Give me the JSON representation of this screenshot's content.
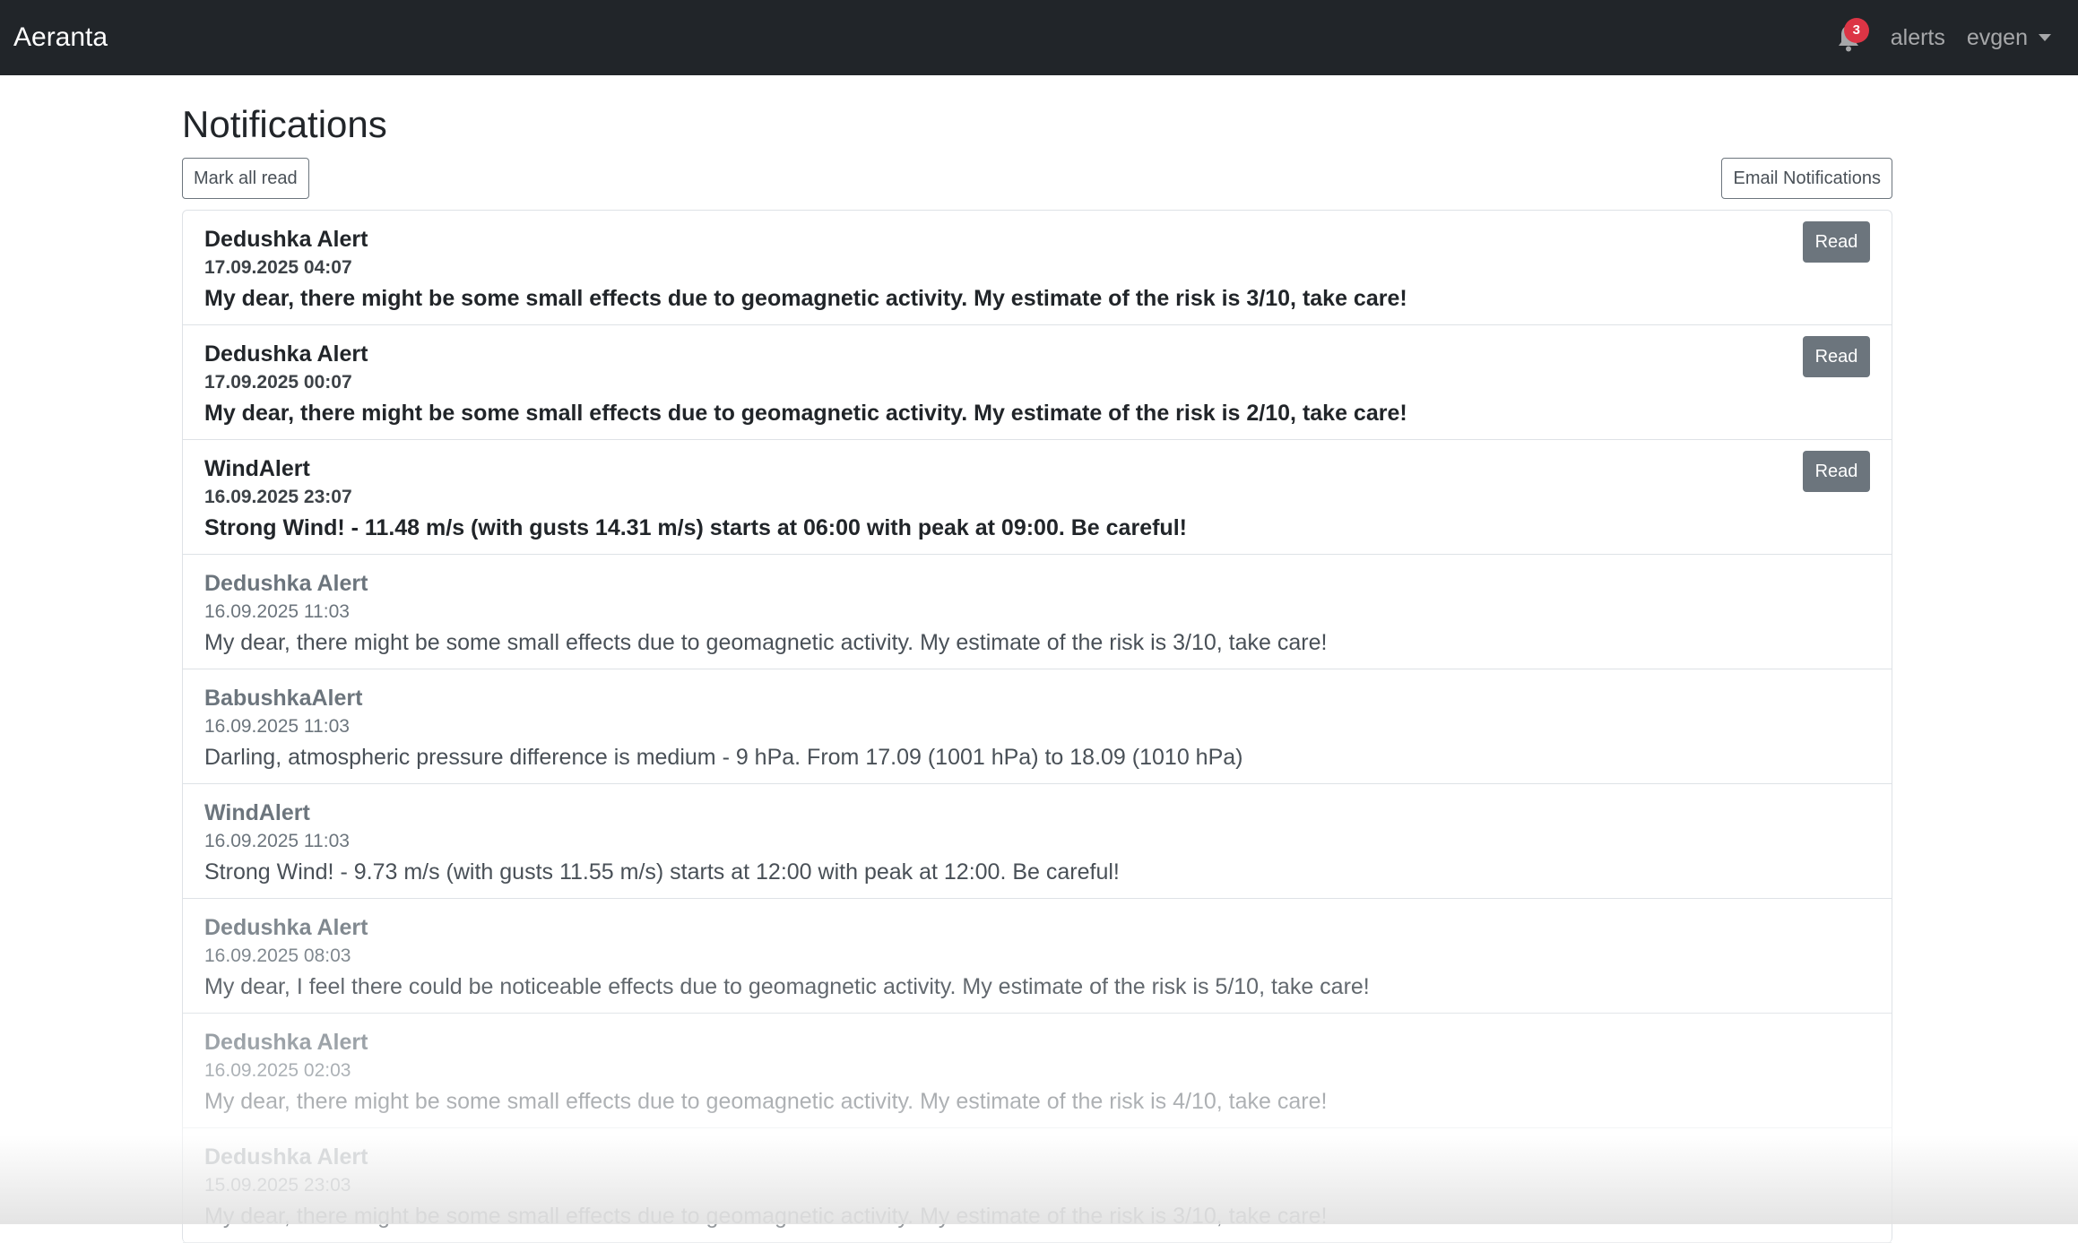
{
  "navbar": {
    "brand": "Aeranta",
    "bell_badge_count": "3",
    "bell_icon": "bell-icon",
    "alerts_link": "alerts",
    "user_menu": "evgen"
  },
  "page": {
    "title": "Notifications",
    "mark_all_read_label": "Mark all read",
    "email_notifications_label": "Email Notifications",
    "read_button_label": "Read"
  },
  "notifications": [
    {
      "title": "Dedushka Alert",
      "date": "17.09.2025 04:07",
      "message": "My dear, there might be some small effects due to geomagnetic activity. My estimate of the risk is 3/10, take care!",
      "unread": true
    },
    {
      "title": "Dedushka Alert",
      "date": "17.09.2025 00:07",
      "message": "My dear, there might be some small effects due to geomagnetic activity. My estimate of the risk is 2/10, take care!",
      "unread": true
    },
    {
      "title": "WindAlert",
      "date": "16.09.2025 23:07",
      "message": "Strong Wind! - 11.48 m/s (with gusts 14.31 m/s) starts at 06:00 with peak at 09:00. Be careful!",
      "unread": true
    },
    {
      "title": "Dedushka Alert",
      "date": "16.09.2025 11:03",
      "message": "My dear, there might be some small effects due to geomagnetic activity. My estimate of the risk is 3/10, take care!",
      "unread": false
    },
    {
      "title": "BabushkaAlert",
      "date": "16.09.2025 11:03",
      "message": "Darling, atmospheric pressure difference is medium - 9 hPa. From 17.09 (1001 hPa) to 18.09 (1010 hPa)",
      "unread": false
    },
    {
      "title": "WindAlert",
      "date": "16.09.2025 11:03",
      "message": "Strong Wind! - 9.73 m/s (with gusts 11.55 m/s) starts at 12:00 with peak at 12:00. Be careful!",
      "unread": false
    },
    {
      "title": "Dedushka Alert",
      "date": "16.09.2025 08:03",
      "message": "My dear, I feel there could be noticeable effects due to geomagnetic activity. My estimate of the risk is 5/10, take care!",
      "unread": false
    },
    {
      "title": "Dedushka Alert",
      "date": "16.09.2025 02:03",
      "message": "My dear, there might be some small effects due to geomagnetic activity. My estimate of the risk is 4/10, take care!",
      "unread": false
    },
    {
      "title": "Dedushka Alert",
      "date": "15.09.2025 23:03",
      "message": "My dear, there might be some small effects due to geomagnetic activity. My estimate of the risk is 3/10, take care!",
      "unread": false
    }
  ]
}
